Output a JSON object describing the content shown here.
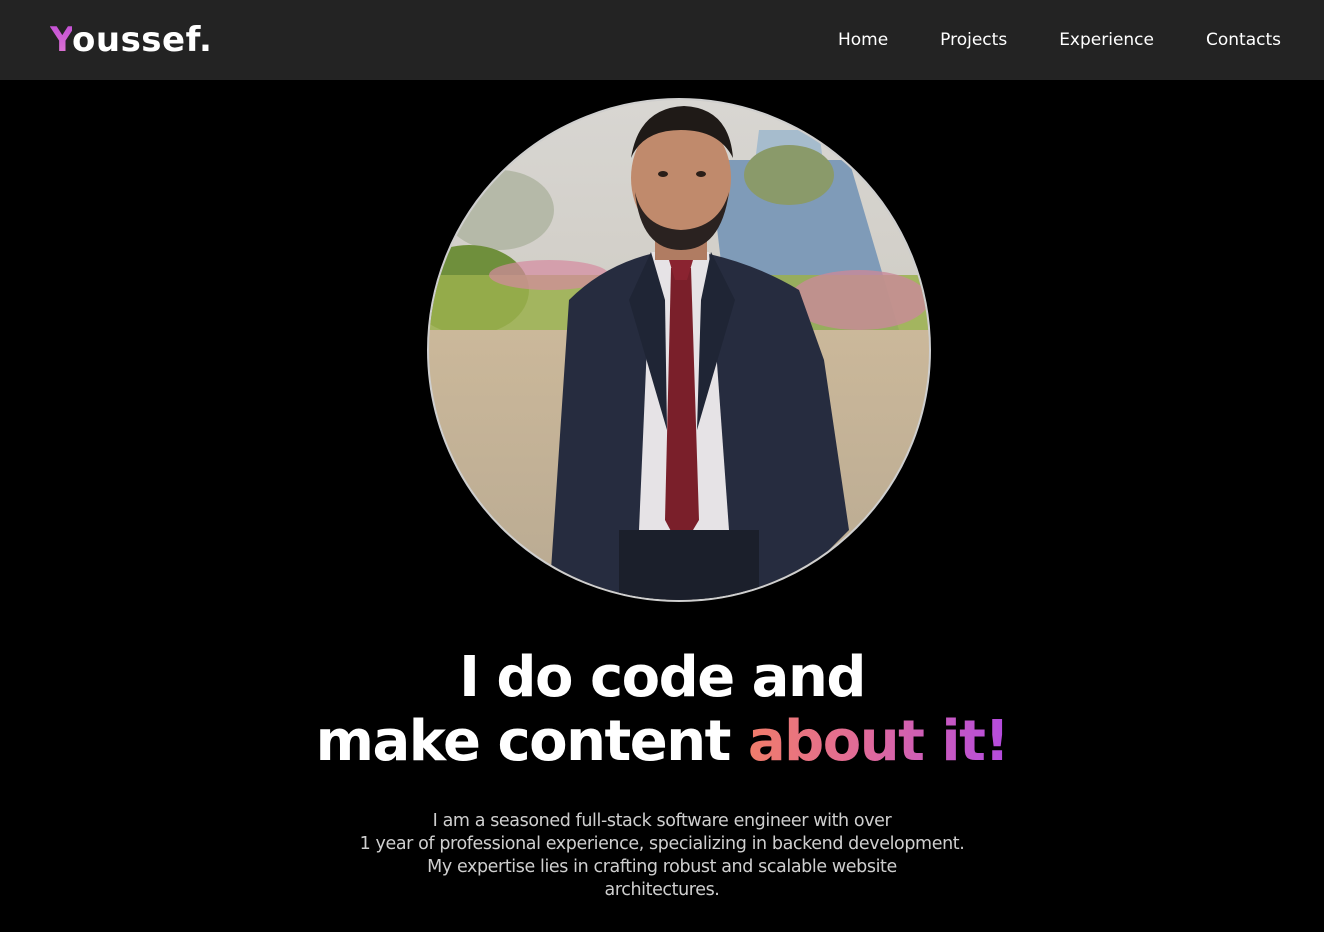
{
  "brand": {
    "logo_first_letter": "Y",
    "logo_rest": "oussef.",
    "accent_color": "#c04ad6"
  },
  "nav": {
    "items": [
      {
        "label": "Home"
      },
      {
        "label": "Projects"
      },
      {
        "label": "Experience"
      },
      {
        "label": "Contacts"
      }
    ]
  },
  "hero": {
    "headline_line1": "I do code and",
    "headline_line2_plain": "make content ",
    "headline_line2_accent": "about it!",
    "bio_lines": [
      "I am a seasoned full-stack software engineer with over",
      "1 year of professional experience, specializing in backend development.",
      "My expertise lies in crafting robust and scalable website",
      "architectures."
    ]
  },
  "colors": {
    "background": "#000000",
    "navbar": "#232323",
    "gradient_start": "#f07c6a",
    "gradient_end": "#b44be0"
  }
}
